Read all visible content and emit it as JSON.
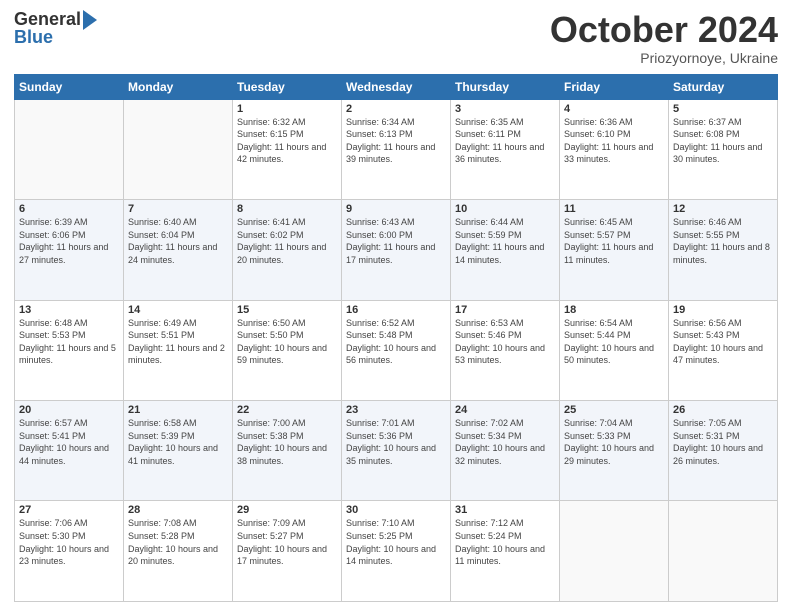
{
  "header": {
    "logo_general": "General",
    "logo_blue": "Blue",
    "month": "October 2024",
    "location": "Priozyornoye, Ukraine"
  },
  "weekdays": [
    "Sunday",
    "Monday",
    "Tuesday",
    "Wednesday",
    "Thursday",
    "Friday",
    "Saturday"
  ],
  "weeks": [
    [
      {
        "day": "",
        "info": ""
      },
      {
        "day": "",
        "info": ""
      },
      {
        "day": "1",
        "info": "Sunrise: 6:32 AM\nSunset: 6:15 PM\nDaylight: 11 hours and 42 minutes."
      },
      {
        "day": "2",
        "info": "Sunrise: 6:34 AM\nSunset: 6:13 PM\nDaylight: 11 hours and 39 minutes."
      },
      {
        "day": "3",
        "info": "Sunrise: 6:35 AM\nSunset: 6:11 PM\nDaylight: 11 hours and 36 minutes."
      },
      {
        "day": "4",
        "info": "Sunrise: 6:36 AM\nSunset: 6:10 PM\nDaylight: 11 hours and 33 minutes."
      },
      {
        "day": "5",
        "info": "Sunrise: 6:37 AM\nSunset: 6:08 PM\nDaylight: 11 hours and 30 minutes."
      }
    ],
    [
      {
        "day": "6",
        "info": "Sunrise: 6:39 AM\nSunset: 6:06 PM\nDaylight: 11 hours and 27 minutes."
      },
      {
        "day": "7",
        "info": "Sunrise: 6:40 AM\nSunset: 6:04 PM\nDaylight: 11 hours and 24 minutes."
      },
      {
        "day": "8",
        "info": "Sunrise: 6:41 AM\nSunset: 6:02 PM\nDaylight: 11 hours and 20 minutes."
      },
      {
        "day": "9",
        "info": "Sunrise: 6:43 AM\nSunset: 6:00 PM\nDaylight: 11 hours and 17 minutes."
      },
      {
        "day": "10",
        "info": "Sunrise: 6:44 AM\nSunset: 5:59 PM\nDaylight: 11 hours and 14 minutes."
      },
      {
        "day": "11",
        "info": "Sunrise: 6:45 AM\nSunset: 5:57 PM\nDaylight: 11 hours and 11 minutes."
      },
      {
        "day": "12",
        "info": "Sunrise: 6:46 AM\nSunset: 5:55 PM\nDaylight: 11 hours and 8 minutes."
      }
    ],
    [
      {
        "day": "13",
        "info": "Sunrise: 6:48 AM\nSunset: 5:53 PM\nDaylight: 11 hours and 5 minutes."
      },
      {
        "day": "14",
        "info": "Sunrise: 6:49 AM\nSunset: 5:51 PM\nDaylight: 11 hours and 2 minutes."
      },
      {
        "day": "15",
        "info": "Sunrise: 6:50 AM\nSunset: 5:50 PM\nDaylight: 10 hours and 59 minutes."
      },
      {
        "day": "16",
        "info": "Sunrise: 6:52 AM\nSunset: 5:48 PM\nDaylight: 10 hours and 56 minutes."
      },
      {
        "day": "17",
        "info": "Sunrise: 6:53 AM\nSunset: 5:46 PM\nDaylight: 10 hours and 53 minutes."
      },
      {
        "day": "18",
        "info": "Sunrise: 6:54 AM\nSunset: 5:44 PM\nDaylight: 10 hours and 50 minutes."
      },
      {
        "day": "19",
        "info": "Sunrise: 6:56 AM\nSunset: 5:43 PM\nDaylight: 10 hours and 47 minutes."
      }
    ],
    [
      {
        "day": "20",
        "info": "Sunrise: 6:57 AM\nSunset: 5:41 PM\nDaylight: 10 hours and 44 minutes."
      },
      {
        "day": "21",
        "info": "Sunrise: 6:58 AM\nSunset: 5:39 PM\nDaylight: 10 hours and 41 minutes."
      },
      {
        "day": "22",
        "info": "Sunrise: 7:00 AM\nSunset: 5:38 PM\nDaylight: 10 hours and 38 minutes."
      },
      {
        "day": "23",
        "info": "Sunrise: 7:01 AM\nSunset: 5:36 PM\nDaylight: 10 hours and 35 minutes."
      },
      {
        "day": "24",
        "info": "Sunrise: 7:02 AM\nSunset: 5:34 PM\nDaylight: 10 hours and 32 minutes."
      },
      {
        "day": "25",
        "info": "Sunrise: 7:04 AM\nSunset: 5:33 PM\nDaylight: 10 hours and 29 minutes."
      },
      {
        "day": "26",
        "info": "Sunrise: 7:05 AM\nSunset: 5:31 PM\nDaylight: 10 hours and 26 minutes."
      }
    ],
    [
      {
        "day": "27",
        "info": "Sunrise: 7:06 AM\nSunset: 5:30 PM\nDaylight: 10 hours and 23 minutes."
      },
      {
        "day": "28",
        "info": "Sunrise: 7:08 AM\nSunset: 5:28 PM\nDaylight: 10 hours and 20 minutes."
      },
      {
        "day": "29",
        "info": "Sunrise: 7:09 AM\nSunset: 5:27 PM\nDaylight: 10 hours and 17 minutes."
      },
      {
        "day": "30",
        "info": "Sunrise: 7:10 AM\nSunset: 5:25 PM\nDaylight: 10 hours and 14 minutes."
      },
      {
        "day": "31",
        "info": "Sunrise: 7:12 AM\nSunset: 5:24 PM\nDaylight: 10 hours and 11 minutes."
      },
      {
        "day": "",
        "info": ""
      },
      {
        "day": "",
        "info": ""
      }
    ]
  ]
}
